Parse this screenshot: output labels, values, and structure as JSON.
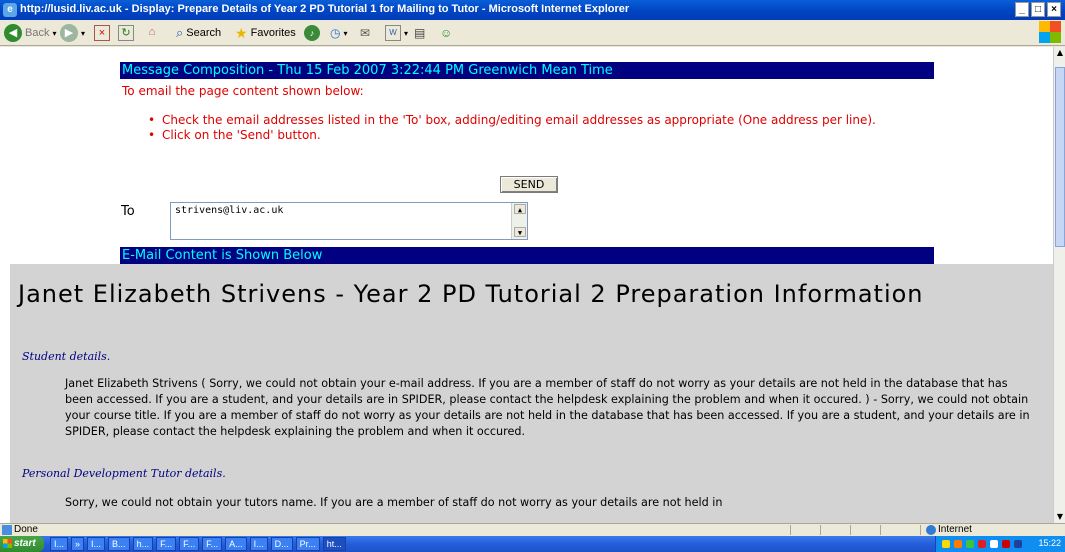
{
  "window": {
    "title": "http://lusid.liv.ac.uk - Display: Prepare Details of Year 2 PD Tutorial 1 for Mailing to Tutor - Microsoft Internet Explorer",
    "minimize": "_",
    "maximize": "□",
    "close": "×"
  },
  "toolbar": {
    "back": "Back",
    "search": "Search",
    "favorites": "Favorites"
  },
  "page": {
    "message_header": "Message Composition - Thu 15 Feb 2007 3:22:44 PM Greenwich Mean Time",
    "intro": "To email the page content shown below:",
    "bullets": [
      "Check the email addresses listed in the 'To' box, adding/editing email addresses as appropriate (One address per line).",
      "Click on the 'Send' button."
    ],
    "send_label": "SEND",
    "to_label": "To",
    "to_value": "strivens@liv.ac.uk",
    "email_header": "E-Mail Content is Shown Below",
    "title": "Janet Elizabeth Strivens - Year 2 PD Tutorial 2 Preparation Information",
    "student_heading": "Student details.",
    "student_text": "Janet Elizabeth Strivens ( Sorry, we could not obtain your e-mail address. If you are a member of staff do not worry as your details are not held in the database that has been accessed. If you are a student, and your details are in SPIDER, please contact the helpdesk explaining the problem and when it occured. ) - Sorry, we could not obtain your course title. If you are a member of staff do not worry as your details are not held in the database that has been accessed. If you are a student, and your details are in SPIDER, please contact the helpdesk explaining the problem and when it occured.",
    "tutor_heading": "Personal Development Tutor details.",
    "tutor_text": "Sorry, we could not obtain your tutors name. If you are a member of staff do not worry as your details are not held in"
  },
  "status": {
    "text": "Done",
    "zone": "Internet"
  },
  "taskbar": {
    "start": "start",
    "tasks": [
      "I...",
      "»",
      "I...",
      "B...",
      "h...",
      "F...",
      "F...",
      "F...",
      "A...",
      "I...",
      "D...",
      "Pr...",
      "ht..."
    ],
    "clock": "15:22"
  },
  "colors": {
    "header_bg": "#000080",
    "header_text": "#00ffff",
    "instruction_text": "#e00000",
    "content_bg": "#d3d3d3"
  }
}
